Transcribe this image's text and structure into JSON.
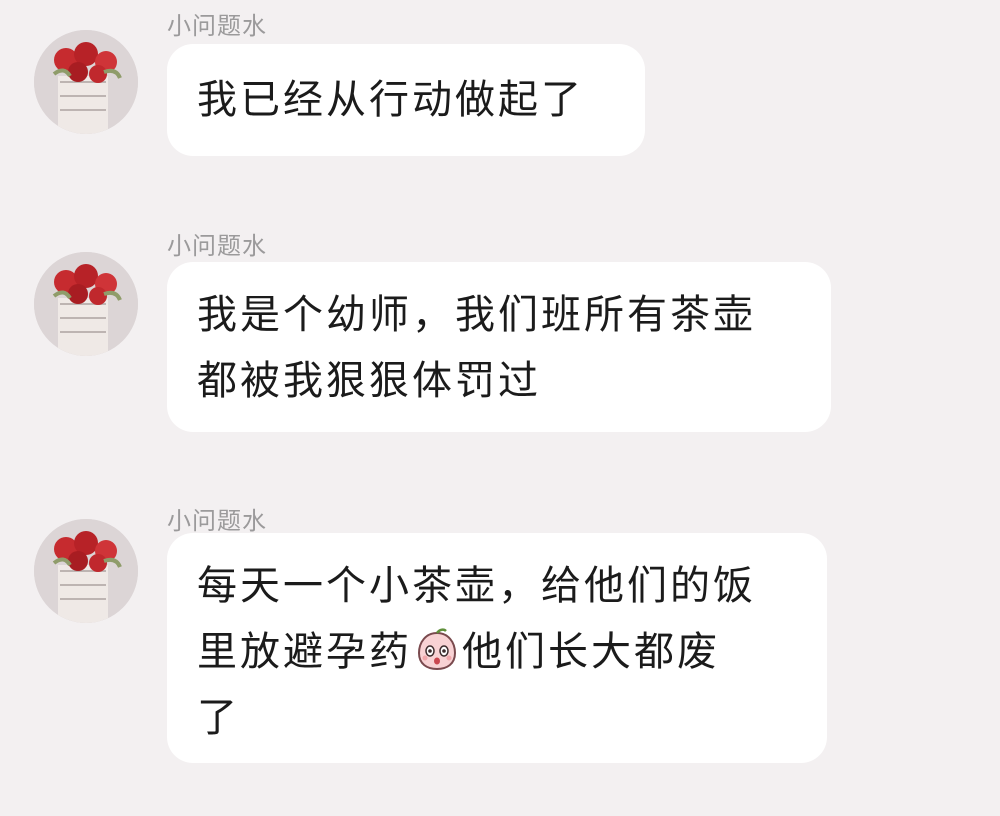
{
  "messages": [
    {
      "sender": "小问题水",
      "avatar": "rose-bouquet-avatar",
      "lines": [
        "我已经从行动做起了"
      ]
    },
    {
      "sender": "小问题水",
      "avatar": "rose-bouquet-avatar",
      "lines": [
        "我是个幼师，我们班所有茶壶",
        "都被我狠狠体罚过"
      ]
    },
    {
      "sender": "小问题水",
      "avatar": "rose-bouquet-avatar",
      "lines_before_emoji": "每天一个小茶壶，给他们的饭",
      "line2_before_emoji": "里放避孕药",
      "emoji": "surprised-peach-emoji",
      "line2_after_emoji": "他们长大都废",
      "line3": "了"
    }
  ],
  "colors": {
    "background": "#f3f0f1",
    "bubble": "#ffffff",
    "sender_name": "#9b9a9b",
    "text": "#1b1b1b"
  }
}
